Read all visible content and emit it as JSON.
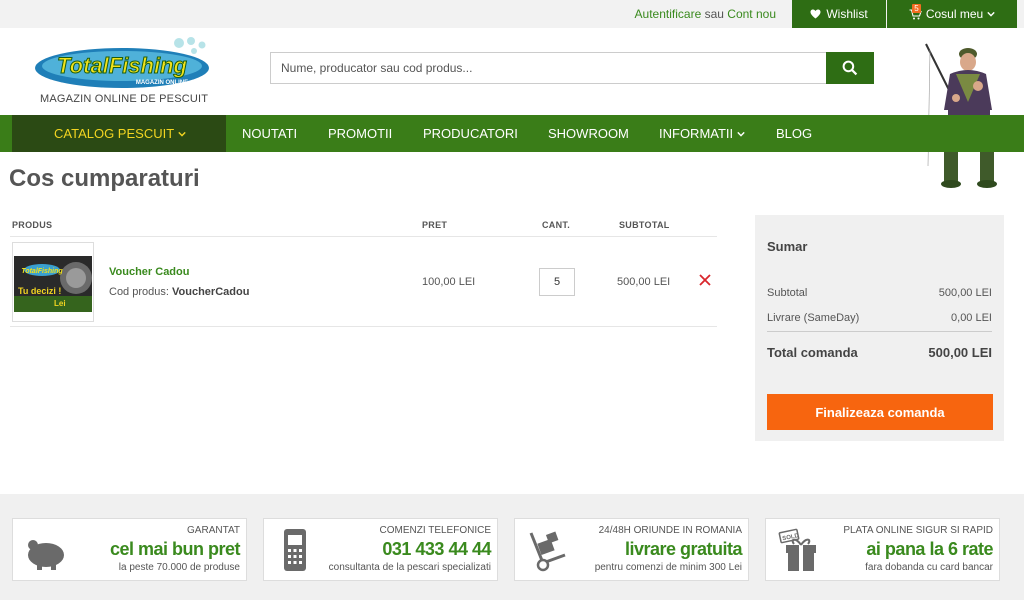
{
  "topbar": {
    "login": "Autentificare",
    "or": "sau",
    "register": "Cont nou",
    "wishlist": "Wishlist",
    "cart_label": "Cosul meu",
    "cart_count": "5"
  },
  "header": {
    "logo_text": "TotalFishing",
    "logo_sub": "MAGAZIN ONLINE",
    "tagline": "MAGAZIN ONLINE DE PESCUIT",
    "search_placeholder": "Nume, producator sau cod produs..."
  },
  "nav": {
    "catalog": "CATALOG PESCUIT",
    "items": [
      "NOUTATI",
      "PROMOTII",
      "PRODUCATORI",
      "SHOWROOM",
      "INFORMATII",
      "BLOG"
    ]
  },
  "page_title": "Cos cumparaturi",
  "table": {
    "headers": {
      "product": "PRODUS",
      "price": "PRET",
      "qty": "CANT.",
      "subtotal": "SUBTOTAL"
    },
    "rows": [
      {
        "name": "Voucher Cadou",
        "code_label": "Cod produs:",
        "code": "VoucherCadou",
        "price": "100,00 LEI",
        "qty": "5",
        "subtotal": "500,00 LEI",
        "image_text": "Tu decizi ! Lei"
      }
    ]
  },
  "summary": {
    "title": "Sumar",
    "subtotal_label": "Subtotal",
    "subtotal_value": "500,00 LEI",
    "shipping_label": "Livrare (SameDay)",
    "shipping_value": "0,00 LEI",
    "total_label": "Total comanda",
    "total_value": "500,00 LEI",
    "checkout": "Finalizeaza comanda"
  },
  "footer": [
    {
      "icon": "piggy-bank-icon",
      "line1": "GARANTAT",
      "line2": "cel mai bun pret",
      "line3": "la peste 70.000 de produse"
    },
    {
      "icon": "phone-icon",
      "line1": "COMENZI TELEFONICE",
      "line2": "031 433 44 44",
      "line3": "consultanta de la pescari specializati"
    },
    {
      "icon": "hand-truck-icon",
      "line1": "24/48H ORIUNDE IN ROMANIA",
      "line2": "livrare gratuita",
      "line3": "pentru comenzi de minim 300 Lei"
    },
    {
      "icon": "gift-icon",
      "line1": "PLATA ONLINE SIGUR SI RAPID",
      "line2": "ai pana la 6 rate",
      "line3": "fara dobanda cu card bancar"
    }
  ],
  "colors": {
    "brand_green": "#3a7d18",
    "dark_green": "#2e6d14",
    "catalog_bg": "#2b4a14",
    "catalog_text": "#f2d421",
    "accent_orange": "#f7650f",
    "link_green": "#3a8a1e"
  }
}
